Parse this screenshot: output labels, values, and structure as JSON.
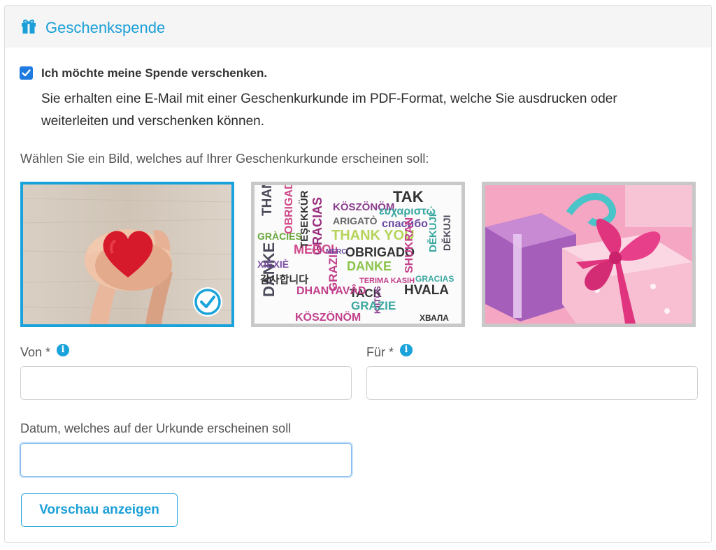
{
  "header": {
    "title": "Geschenkspende",
    "icon": "gift-icon"
  },
  "gift": {
    "checkbox_checked": true,
    "checkbox_label": "Ich möchte meine Spende verschenken.",
    "description": "Sie erhalten eine E-Mail mit einer Geschenkurkunde im PDF-Format, welche Sie ausdrucken oder weiterleiten und verschenken können."
  },
  "image_picker": {
    "prompt": "Wählen Sie ein Bild, welches auf Ihrer Geschenkurkunde erscheinen soll:",
    "selected_index": 0,
    "images": [
      {
        "name": "hands-heart"
      },
      {
        "name": "thank-you-words"
      },
      {
        "name": "pink-gifts"
      }
    ]
  },
  "words_image": {
    "words": [
      "THANK",
      "DANKE",
      "GRACIAS",
      "KÖSZÖNÖM",
      "TAK",
      "ευχαριστώ",
      "спасибо",
      "ARIGATÒ",
      "THANK YOU",
      "MERCI",
      "OBRIGADO",
      "GRAZIE",
      "DANKE",
      "XIÈXIÈ",
      "감사합니다",
      "DĚKUJI",
      "GRÀCIES",
      "TACK",
      "HVALA",
      "DHANYAVÂD",
      "KIITOS",
      "TERIMA KASIH",
      "GRAZIE",
      "KÖSZÖNÖM",
      "ХВАЛА",
      "SHUKRAN",
      "MERCI",
      "TEŞEKKÜR",
      "OBRIGADI",
      "DĚKUJI",
      "GRACIAS"
    ]
  },
  "form": {
    "from_label": "Von *",
    "from_value": "",
    "for_label": "Für *",
    "for_value": "",
    "date_label": "Datum, welches auf der Urkunde erscheinen soll",
    "date_value": "",
    "preview_button": "Vorschau anzeigen"
  },
  "colors": {
    "accent": "#1aa3da",
    "checkbox": "#1e7be0",
    "header_bg": "#f5f5f5"
  }
}
